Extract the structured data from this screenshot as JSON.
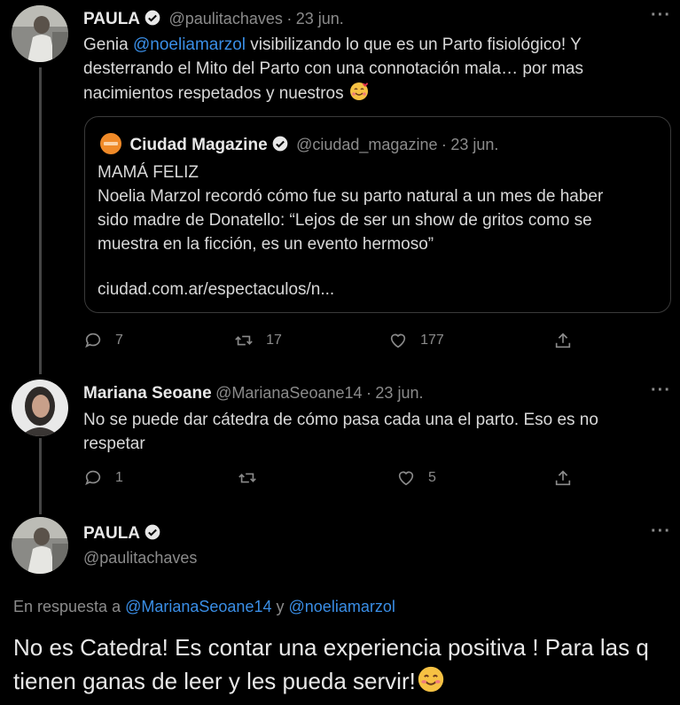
{
  "tweet1": {
    "name": "PAULA",
    "handle": "@paulitachaves",
    "date": "23 jun.",
    "text_pre": "Genia ",
    "mention": "@noeliamarzol",
    "text_post": " visibilizando lo que es un Parto fisiológico! Y desterrando el Mito del Parto con una connotación mala… por mas nacimientos respetados y nuestros",
    "replies": "7",
    "retweets": "17",
    "likes": "177"
  },
  "quote": {
    "name": "Ciudad Magazine",
    "handle": "@ciudad_magazine",
    "date": "23 jun.",
    "line1": "MAMÁ FELIZ",
    "body": "Noelia Marzol recordó cómo fue su parto natural a un mes de haber sido madre de Donatello: “Lejos de ser un show de gritos como se muestra en la ficción, es un evento hermoso”",
    "link": "ciudad.com.ar/espectaculos/n..."
  },
  "tweet2": {
    "name": "Mariana Seoane",
    "handle": "@MarianaSeoane14",
    "date": "23 jun.",
    "text": "No se puede dar cátedra de cómo pasa cada una el parto. Eso es no respetar",
    "replies": "1",
    "likes": "5"
  },
  "tweet3": {
    "name": "PAULA",
    "handle": "@paulitachaves",
    "replying_prefix": "En respuesta a",
    "replying_user1": "@MarianaSeoane14",
    "replying_and": "y",
    "replying_user2": "@noeliamarzol",
    "text": "No es Catedra! Es contar una experiencia positiva ! Para las q tienen ganas de leer y les pueda servir!"
  },
  "more_label": "···",
  "dot_sep": "·",
  "colors": {
    "background": "#000000",
    "link": "#3a8ee6",
    "muted": "#8b8b8b"
  }
}
